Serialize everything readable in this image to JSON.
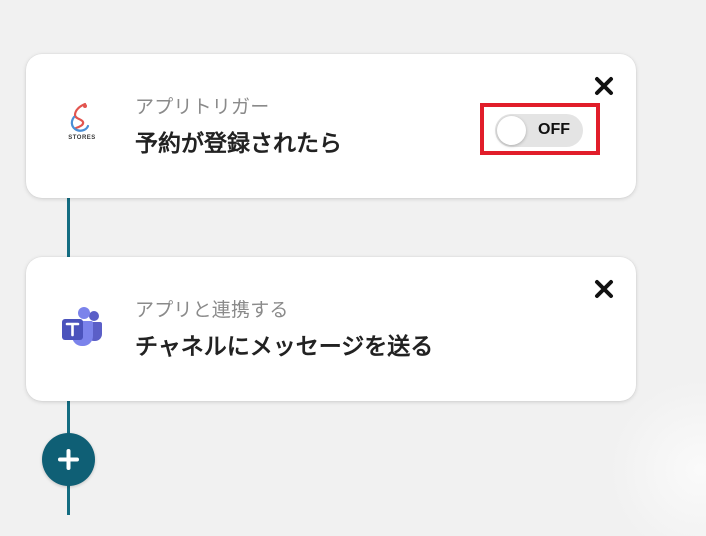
{
  "flow": {
    "trigger": {
      "subtitle": "アプリトリガー",
      "title": "予約が登録されたら",
      "app_name": "STORES",
      "app_icon": "stores-logo-icon",
      "toggle_label": "OFF",
      "toggle_state": "off"
    },
    "action": {
      "subtitle": "アプリと連携する",
      "title": "チャネルにメッセージを送る",
      "app_icon": "microsoft-teams-icon"
    },
    "add_step_icon": "plus-icon",
    "close_icon": "close-icon"
  },
  "colors": {
    "connector": "#146d82",
    "add_button": "#0f5f75",
    "highlight": "#e11d2a",
    "teams_purple": "#5b5fc7"
  }
}
